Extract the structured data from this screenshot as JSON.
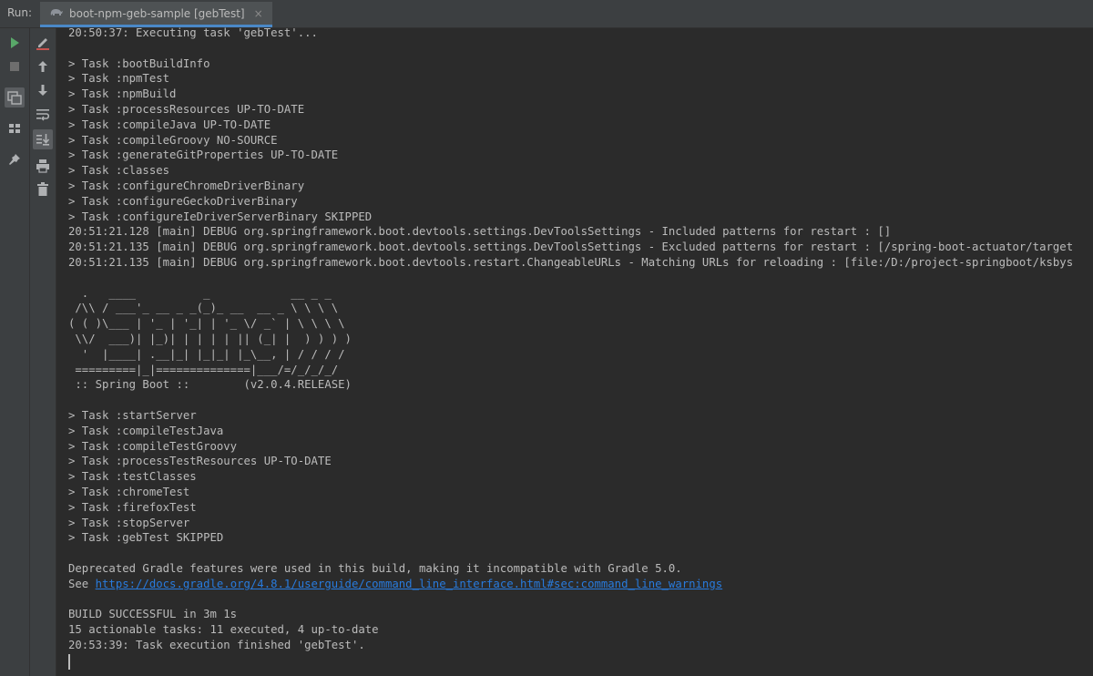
{
  "toolbar": {
    "run_label": "Run:"
  },
  "tab": {
    "title": "boot-npm-geb-sample [gebTest]",
    "close": "×"
  },
  "colors": {
    "accent": "#4a88c7",
    "link": "#287bde",
    "run_green": "#59a869",
    "edit_red": "#c75450"
  },
  "console": {
    "lines": [
      {
        "text": "20:50:37: Executing task 'gebTest'..."
      },
      {
        "text": ""
      },
      {
        "text": "> Task :bootBuildInfo"
      },
      {
        "text": "> Task :npmTest"
      },
      {
        "text": "> Task :npmBuild"
      },
      {
        "text": "> Task :processResources UP-TO-DATE"
      },
      {
        "text": "> Task :compileJava UP-TO-DATE"
      },
      {
        "text": "> Task :compileGroovy NO-SOURCE"
      },
      {
        "text": "> Task :generateGitProperties UP-TO-DATE"
      },
      {
        "text": "> Task :classes"
      },
      {
        "text": "> Task :configureChromeDriverBinary"
      },
      {
        "text": "> Task :configureGeckoDriverBinary"
      },
      {
        "text": "> Task :configureIeDriverServerBinary SKIPPED"
      },
      {
        "text": "20:51:21.128 [main] DEBUG org.springframework.boot.devtools.settings.DevToolsSettings - Included patterns for restart : []"
      },
      {
        "text": "20:51:21.135 [main] DEBUG org.springframework.boot.devtools.settings.DevToolsSettings - Excluded patterns for restart : [/spring-boot-actuator/target"
      },
      {
        "text": "20:51:21.135 [main] DEBUG org.springframework.boot.devtools.restart.ChangeableURLs - Matching URLs for reloading : [file:/D:/project-springboot/ksbys"
      },
      {
        "text": ""
      },
      {
        "text": "  .   ____          _            __ _ _"
      },
      {
        "text": " /\\\\ / ___'_ __ _ _(_)_ __  __ _ \\ \\ \\ \\"
      },
      {
        "text": "( ( )\\___ | '_ | '_| | '_ \\/ _` | \\ \\ \\ \\"
      },
      {
        "text": " \\\\/  ___)| |_)| | | | | || (_| |  ) ) ) )"
      },
      {
        "text": "  '  |____| .__|_| |_|_| |_\\__, | / / / /"
      },
      {
        "text": " =========|_|==============|___/=/_/_/_/"
      },
      {
        "text": " :: Spring Boot ::        (v2.0.4.RELEASE)"
      },
      {
        "text": ""
      },
      {
        "text": "> Task :startServer"
      },
      {
        "text": "> Task :compileTestJava"
      },
      {
        "text": "> Task :compileTestGroovy"
      },
      {
        "text": "> Task :processTestResources UP-TO-DATE"
      },
      {
        "text": "> Task :testClasses"
      },
      {
        "text": "> Task :chromeTest"
      },
      {
        "text": "> Task :firefoxTest"
      },
      {
        "text": "> Task :stopServer"
      },
      {
        "text": "> Task :gebTest SKIPPED"
      },
      {
        "text": ""
      },
      {
        "text": "Deprecated Gradle features were used in this build, making it incompatible with Gradle 5.0."
      },
      {
        "text": "See ",
        "link": "https://docs.gradle.org/4.8.1/userguide/command_line_interface.html#sec:command_line_warnings"
      },
      {
        "text": ""
      },
      {
        "text": "BUILD SUCCESSFUL in 3m 1s"
      },
      {
        "text": "15 actionable tasks: 11 executed, 4 up-to-date"
      },
      {
        "text": "20:53:39: Task execution finished 'gebTest'."
      }
    ]
  }
}
